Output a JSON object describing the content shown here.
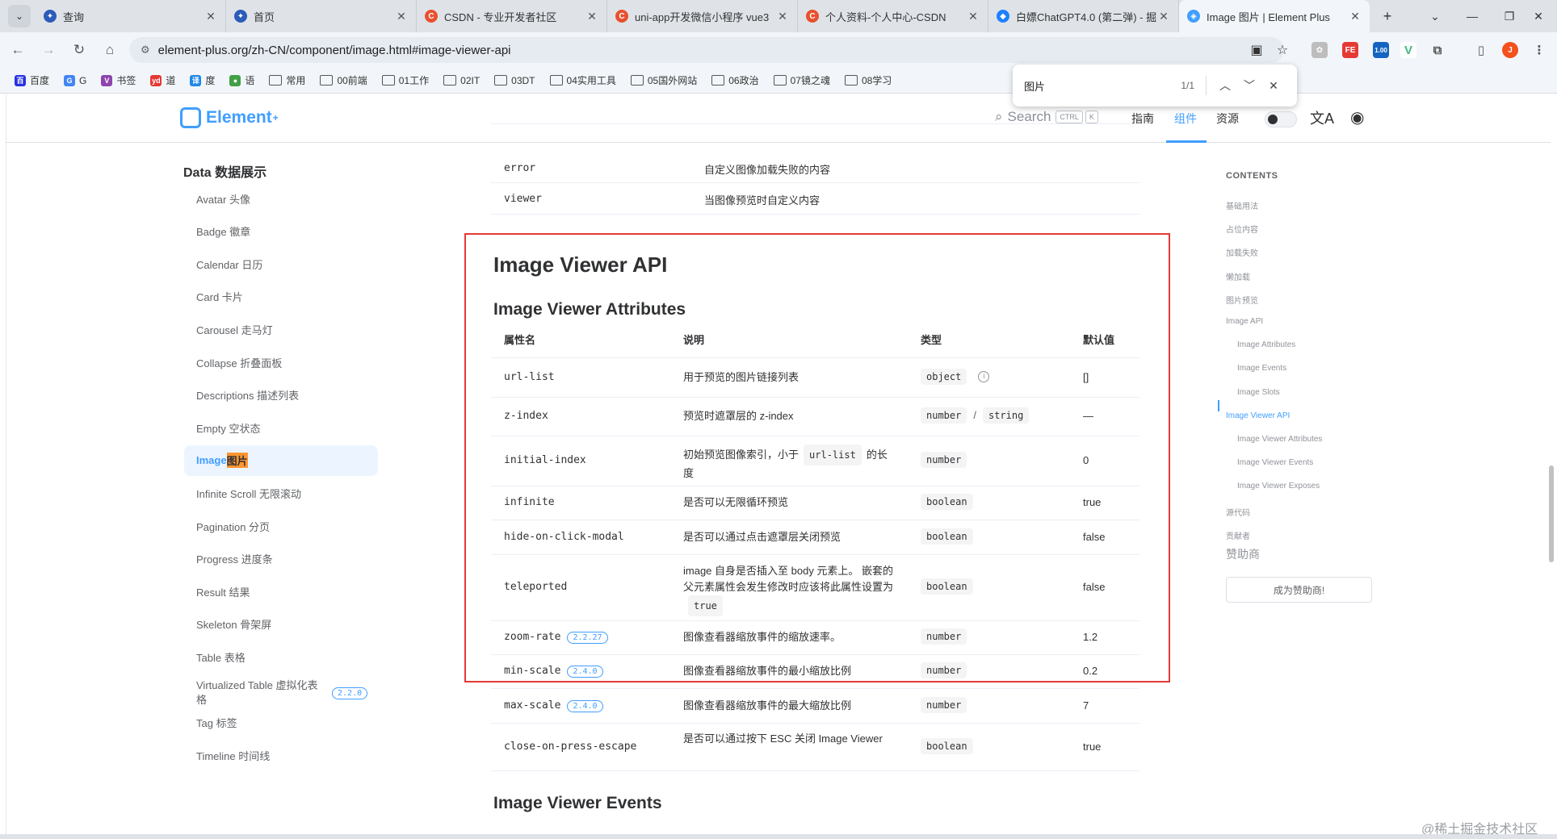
{
  "browser": {
    "tabs": [
      {
        "title": "查询",
        "fav_color": "#2d5bb9",
        "fav_glyph": "✦"
      },
      {
        "title": "首页",
        "fav_color": "#2d5bb9",
        "fav_glyph": "✦"
      },
      {
        "title": "CSDN - 专业开发者社区",
        "fav_color": "#e8502e",
        "fav_glyph": "C"
      },
      {
        "title": "uni-app开发微信小程序 vue3",
        "fav_color": "#e8502e",
        "fav_glyph": "C"
      },
      {
        "title": "个人资料-个人中心-CSDN",
        "fav_color": "#e8502e",
        "fav_glyph": "C"
      },
      {
        "title": "白嫖ChatGPT4.0 (第二弹) - 掘",
        "fav_color": "#1e80ff",
        "fav_glyph": "◆"
      },
      {
        "title": "Image 图片 | Element Plus",
        "fav_color": "#409eff",
        "fav_glyph": "◈",
        "active": true
      }
    ],
    "url": "element-plus.org/zh-CN/component/image.html#image-viewer-api",
    "ext_badge": "1.00",
    "profile_initial": "J",
    "bookmarks": [
      {
        "label": "百度",
        "kind": "color",
        "color": "#2932e1",
        "glyph": "百"
      },
      {
        "label": "G",
        "kind": "color",
        "color": "#4285f4",
        "glyph": "G"
      },
      {
        "label": "书签",
        "kind": "color",
        "color": "#8e44ad",
        "glyph": "V"
      },
      {
        "label": "道",
        "kind": "color",
        "color": "#e53935",
        "glyph": "yd"
      },
      {
        "label": "度",
        "kind": "color",
        "color": "#1e88e5",
        "glyph": "译"
      },
      {
        "label": "语",
        "kind": "color",
        "color": "#43a047",
        "glyph": "●"
      },
      {
        "label": "常用",
        "kind": "folder"
      },
      {
        "label": "00前端",
        "kind": "folder"
      },
      {
        "label": "01工作",
        "kind": "folder"
      },
      {
        "label": "02IT",
        "kind": "folder"
      },
      {
        "label": "03DT",
        "kind": "folder"
      },
      {
        "label": "04实用工具",
        "kind": "folder"
      },
      {
        "label": "05国外网站",
        "kind": "folder"
      },
      {
        "label": "06政治",
        "kind": "folder"
      },
      {
        "label": "07镜之魂",
        "kind": "folder"
      },
      {
        "label": "08学习",
        "kind": "folder"
      }
    ],
    "find": {
      "query": "图片",
      "count": "1/1"
    }
  },
  "header": {
    "logo": "Element",
    "logo_sup": "+",
    "search_label": "Search",
    "kbd_ctrl": "CTRL",
    "kbd_k": "K",
    "nav": [
      "指南",
      "组件",
      "资源"
    ],
    "lang_icon": "文A"
  },
  "sidebar": {
    "title": "Data 数据展示",
    "items": [
      {
        "label": "Avatar 头像"
      },
      {
        "label": "Badge 徽章"
      },
      {
        "label": "Calendar 日历"
      },
      {
        "label": "Card 卡片"
      },
      {
        "label": "Carousel 走马灯"
      },
      {
        "label": "Collapse 折叠面板"
      },
      {
        "label": "Descriptions 描述列表"
      },
      {
        "label": "Empty 空状态"
      },
      {
        "label": "Image ",
        "highlight": "图片",
        "active": true
      },
      {
        "label": "Infinite Scroll 无限滚动"
      },
      {
        "label": "Pagination 分页"
      },
      {
        "label": "Progress 进度条"
      },
      {
        "label": "Result 结果"
      },
      {
        "label": "Skeleton 骨架屏"
      },
      {
        "label": "Table 表格"
      },
      {
        "label": "Virtualized Table 虚拟化表格",
        "version": "2.2.0"
      },
      {
        "label": "Tag 标签"
      },
      {
        "label": "Timeline 时间线"
      }
    ]
  },
  "slots_table": {
    "rows": [
      {
        "name": "error",
        "desc": "自定义图像加载失败的内容"
      },
      {
        "name": "viewer",
        "desc": "当图像预览时自定义内容"
      }
    ]
  },
  "viewer_api": {
    "heading": "Image Viewer API",
    "attributes_heading": "Image Viewer Attributes",
    "columns": [
      "属性名",
      "说明",
      "类型",
      "默认值"
    ],
    "rows": [
      {
        "name": "url-list",
        "desc": "用于预览的图片链接列表",
        "types": [
          "object"
        ],
        "info": true,
        "default": "[]"
      },
      {
        "name": "z-index",
        "desc": "预览时遮罩层的 z-index",
        "types": [
          "number",
          "string"
        ],
        "default": "—"
      },
      {
        "name": "initial-index",
        "desc_pre": "初始预览图像索引，小于",
        "desc_code": "url-list",
        "desc_post": "的长度",
        "types": [
          "number"
        ],
        "default": "0"
      },
      {
        "name": "infinite",
        "desc": "是否可以无限循环预览",
        "types": [
          "boolean"
        ],
        "default": "true"
      },
      {
        "name": "hide-on-click-modal",
        "desc": "是否可以通过点击遮罩层关闭预览",
        "types": [
          "boolean"
        ],
        "default": "false"
      },
      {
        "name": "teleported",
        "desc_pre": "image 自身是否插入至 body 元素上。 嵌套的父元素属性会发生修改时应该将此属性设置为",
        "desc_code": "true",
        "desc_post": "",
        "types": [
          "boolean"
        ],
        "default": "false"
      },
      {
        "name": "zoom-rate",
        "version": "2.2.27",
        "desc": "图像查看器缩放事件的缩放速率。",
        "types": [
          "number"
        ],
        "default": "1.2"
      },
      {
        "name": "min-scale",
        "version": "2.4.0",
        "desc": "图像查看器缩放事件的最小缩放比例",
        "types": [
          "number"
        ],
        "default": "0.2"
      },
      {
        "name": "max-scale",
        "version": "2.4.0",
        "desc": "图像查看器缩放事件的最大缩放比例",
        "types": [
          "number"
        ],
        "default": "7"
      },
      {
        "name": "close-on-press-escape",
        "desc": "是否可以通过按下 ESC 关闭 Image Viewer",
        "types": [
          "boolean"
        ],
        "default": "true"
      }
    ],
    "events_heading": "Image Viewer Events"
  },
  "toc": {
    "title": "CONTENTS",
    "items": [
      {
        "label": "基础用法",
        "level": 1
      },
      {
        "label": "占位内容",
        "level": 1
      },
      {
        "label": "加载失败",
        "level": 1
      },
      {
        "label": "懒加载",
        "level": 1
      },
      {
        "label": "图片预览",
        "level": 1
      },
      {
        "label": "Image API",
        "level": 1
      },
      {
        "label": "Image Attributes",
        "level": 2
      },
      {
        "label": "Image Events",
        "level": 2
      },
      {
        "label": "Image Slots",
        "level": 2
      },
      {
        "label": "Image Viewer API",
        "level": 1,
        "active": true
      },
      {
        "label": "Image Viewer Attributes",
        "level": 2
      },
      {
        "label": "Image Viewer Events",
        "level": 2
      },
      {
        "label": "Image Viewer Exposes",
        "level": 2
      },
      {
        "label": "源代码",
        "level": 1
      },
      {
        "label": "贡献者",
        "level": 1
      }
    ],
    "sponsor_title": "赞助商",
    "sponsor_button": "成为赞助商!"
  },
  "watermark": "@稀土掘金技术社区"
}
